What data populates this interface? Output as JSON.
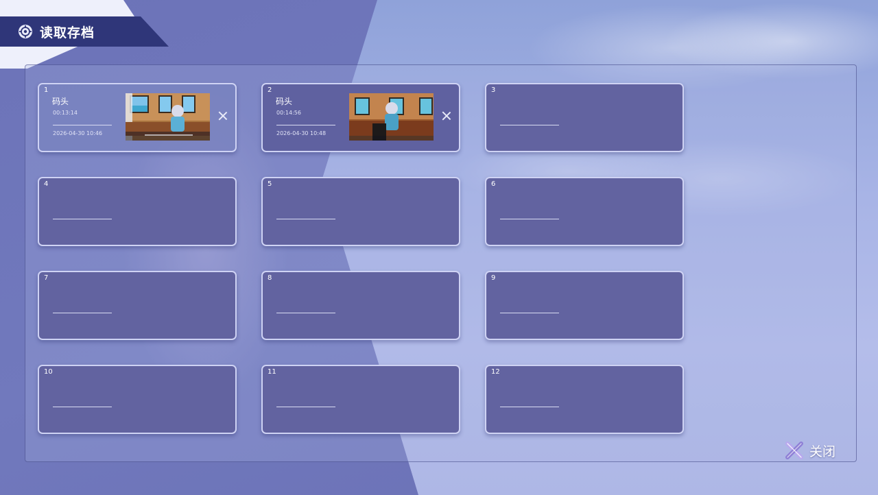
{
  "header": {
    "title": "读取存档"
  },
  "slots": [
    {
      "num": "1",
      "title": "码头",
      "playtime": "00:13:14",
      "date": "2026-04-30 10:46",
      "has_save": true
    },
    {
      "num": "2",
      "title": "码头",
      "playtime": "00:14:56",
      "date": "2026-04-30 10:48",
      "has_save": true
    },
    {
      "num": "3",
      "has_save": false
    },
    {
      "num": "4",
      "has_save": false
    },
    {
      "num": "5",
      "has_save": false
    },
    {
      "num": "6",
      "has_save": false
    },
    {
      "num": "7",
      "has_save": false
    },
    {
      "num": "8",
      "has_save": false
    },
    {
      "num": "9",
      "has_save": false
    },
    {
      "num": "10",
      "has_save": false
    },
    {
      "num": "11",
      "has_save": false
    },
    {
      "num": "12",
      "has_save": false
    }
  ],
  "footer": {
    "close_label": "关闭"
  },
  "icons": {
    "header": "crosshair-gear-icon",
    "delete": "close-x-icon",
    "close": "close-x-icon"
  },
  "colors": {
    "header_bg": "#2f3679",
    "slot_bg": "#6263a0",
    "slot_border": "#cfd3f4",
    "accent": "#8e7fd6"
  }
}
